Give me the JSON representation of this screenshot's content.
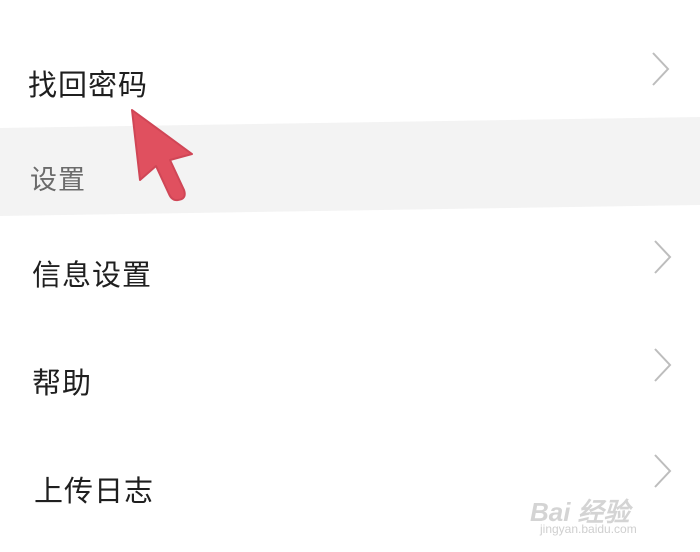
{
  "menu": {
    "items_top": [
      {
        "label": "找回密码",
        "icon": "chevron-right-icon"
      }
    ],
    "section_header": "设置",
    "items_settings": [
      {
        "label": "信息设置",
        "icon": "chevron-right-icon"
      },
      {
        "label": "帮助",
        "icon": "chevron-right-icon"
      },
      {
        "label": "上传日志",
        "icon": "chevron-right-icon"
      }
    ]
  },
  "annotation": {
    "pointer": "red-arrow-icon",
    "color": "#e0505f"
  },
  "watermark": {
    "logo": "Bai 经验",
    "url": "jingyan.baidu.com"
  },
  "colors": {
    "background": "#ffffff",
    "section_band": "#f3f3f3",
    "text_primary": "#1f1f1f",
    "text_section": "#6b6b6b",
    "chevron": "#bdbdbd"
  }
}
